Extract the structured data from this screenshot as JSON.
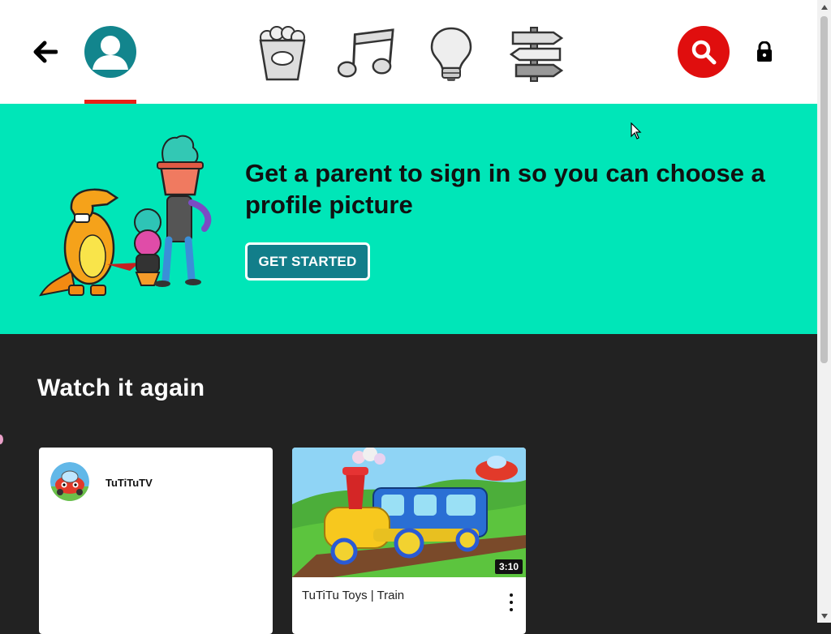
{
  "header": {
    "back_icon": "arrow-left-icon",
    "profile_icon": "person-icon",
    "categories": [
      {
        "name": "Shows",
        "icon": "popcorn-icon"
      },
      {
        "name": "Music",
        "icon": "music-note-icon"
      },
      {
        "name": "Learning",
        "icon": "lightbulb-icon"
      },
      {
        "name": "Explore",
        "icon": "signpost-icon"
      }
    ],
    "search_icon": "search-icon",
    "lock_icon": "lock-icon"
  },
  "banner": {
    "title": "Get a parent to sign in so you can choose a profile picture",
    "button_label": "GET STARTED"
  },
  "watch_again": {
    "title": "Watch it again",
    "channel_card": {
      "name": "TuTiTuTV"
    },
    "video_card": {
      "title": "TuTiTu Toys | Train",
      "duration": "3:10"
    }
  },
  "colors": {
    "accent_red": "#e00e0e",
    "banner_bg": "#00e6b8",
    "profile_teal": "#12858d",
    "button_teal": "#127e8a",
    "page_bg": "#222222"
  }
}
